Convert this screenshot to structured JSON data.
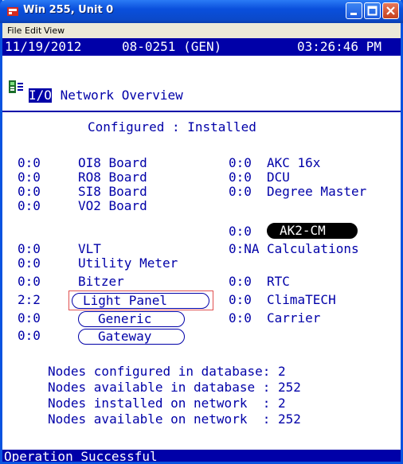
{
  "window": {
    "title": "Win 255, Unit 0",
    "title_color": "#0a4fdc"
  },
  "menu": {
    "file": "File",
    "edit": "Edit",
    "view": "View"
  },
  "header": {
    "date": "11/19/2012",
    "model": "08-0251 (GEN)",
    "time": "03:26:46 PM"
  },
  "page": {
    "highlight_title": "I/O",
    "title_rest": " Network Overview"
  },
  "columns_header": "Configured : Installed",
  "left_rows": [
    {
      "count": "0:0",
      "label": "OI8 Board"
    },
    {
      "count": "0:0",
      "label": "RO8 Board"
    },
    {
      "count": "0:0",
      "label": "SI8 Board"
    },
    {
      "count": "0:0",
      "label": "VO2 Board"
    },
    {
      "count": "0:0",
      "label": "VLT"
    },
    {
      "count": "0:0",
      "label": "Utility Meter"
    },
    {
      "count": "0:0",
      "label": "Bitzer"
    },
    {
      "count": "2:2",
      "label": "Light Panel"
    },
    {
      "count": "0:0",
      "label": "Generic"
    },
    {
      "count": "0:0",
      "label": "Gateway"
    }
  ],
  "right_rows": [
    {
      "count": "0:0",
      "label": "AKC 16x"
    },
    {
      "count": "0:0",
      "label": "DCU"
    },
    {
      "count": "0:0",
      "label": "Degree Master"
    },
    {
      "count": "0:0",
      "label": "AK2-CM"
    },
    {
      "count": "0:NA",
      "label": "Calculations"
    },
    {
      "count": "0:0",
      "label": "RTC"
    },
    {
      "count": "0:0",
      "label": "ClimaTECH"
    },
    {
      "count": "0:0",
      "label": "Carrier"
    }
  ],
  "summary": [
    "Nodes configured in database: 2",
    "Nodes available in database : 252",
    "Nodes installed on network  : 2",
    "Nodes available on network  : 252"
  ],
  "status": "Operation Successful",
  "colors": {
    "screen_text": "#0000a8",
    "selection_border": "#e05050",
    "pill_active": "#000000"
  }
}
